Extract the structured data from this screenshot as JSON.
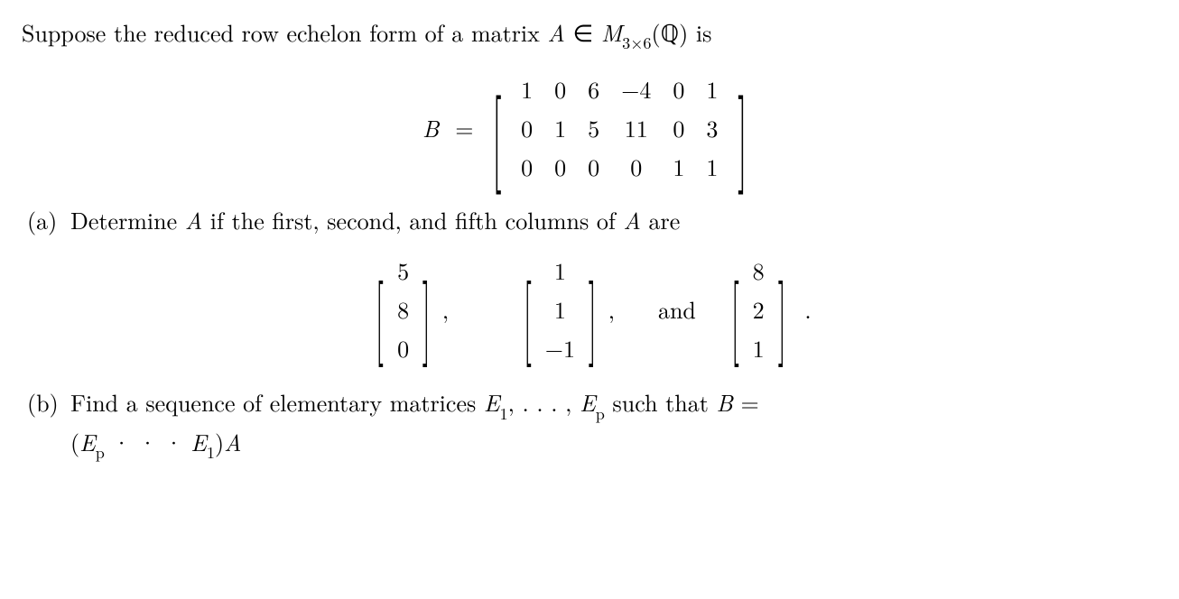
{
  "intro": {
    "text_before_A": "Suppose the reduced row echelon form of a matrix ",
    "A": "A",
    "in": " ∈ ",
    "M": "M",
    "dims": "3×6",
    "lparen": "(",
    "Q": "ℚ",
    "rparen": ")",
    "is": " is"
  },
  "matrix_B": {
    "label": "B",
    "equals": "=",
    "rows": [
      [
        "1",
        "0",
        "6",
        "−4",
        "0",
        "1"
      ],
      [
        "0",
        "1",
        "5",
        "11",
        "0",
        "3"
      ],
      [
        "0",
        "0",
        "0",
        "0",
        "1",
        "1"
      ]
    ]
  },
  "part_a": {
    "label": "(a)",
    "text_before": "Determine ",
    "A1": "A",
    "text_mid": " if the first, second, and fifth columns of ",
    "A2": "A",
    "text_after": " are"
  },
  "columns": {
    "col1": [
      "5",
      "8",
      "0"
    ],
    "col2": [
      "1",
      "1",
      "−1"
    ],
    "col3": [
      "8",
      "2",
      "1"
    ],
    "comma": ",",
    "and": "and",
    "period": "."
  },
  "part_b": {
    "label": "(b)",
    "text1": "Find a sequence of elementary matrices ",
    "E1": "E",
    "sub1": "1",
    "dots": ", . . . , ",
    "Ep": "E",
    "subp": "p",
    "text2": " such that ",
    "B": "B",
    "eq": " =",
    "line2_lparen": "(",
    "line2_Ep": "E",
    "line2_subp": "p",
    "line2_cdots": " · · · ",
    "line2_E1": "E",
    "line2_sub1": "1",
    "line2_rparen": ")",
    "line2_A": "A"
  }
}
